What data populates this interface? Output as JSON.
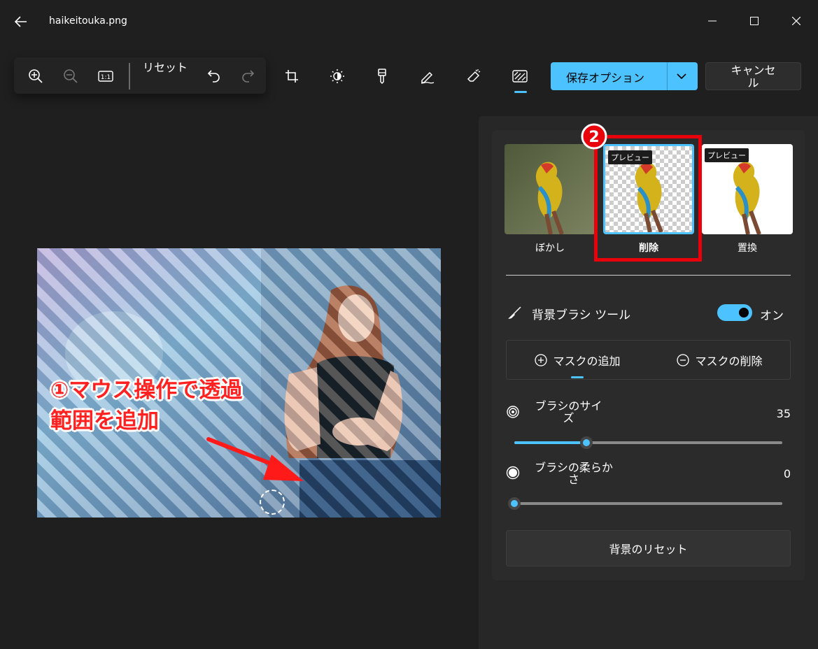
{
  "window": {
    "title": "haikeitouka.png"
  },
  "toolbar": {
    "reset_label": "リセット",
    "save_label": "保存オプション",
    "cancel_label": "キャンセル",
    "icons": [
      "zoom-in-icon",
      "zoom-out-icon",
      "actual-size-icon",
      "undo-icon",
      "redo-icon",
      "crop-icon",
      "brightness-icon",
      "filter-icon",
      "markup-icon",
      "erase-icon",
      "background-icon"
    ],
    "accent_color": "#4cc2ff"
  },
  "panel": {
    "options": [
      {
        "label": "ぼかし",
        "preview": ""
      },
      {
        "label": "削除",
        "preview": "プレビュー"
      },
      {
        "label": "置換",
        "preview": "プレビュー"
      }
    ],
    "brush_tool": {
      "label": "背景ブラシ ツール",
      "toggle_label": "オン",
      "on": true
    },
    "mask": {
      "add_label": "マスクの追加",
      "remove_label": "マスクの削除",
      "selected": "add"
    },
    "brush_size": {
      "label": "ブラシのサイズ",
      "value": "35",
      "fraction": 0.27
    },
    "brush_softness": {
      "label": "ブラシの柔らかさ",
      "value": "0",
      "fraction": 0.0
    },
    "reset_background_label": "背景のリセット"
  },
  "annotations": {
    "step1": "①マウス操作で透過範囲を追加",
    "step2": "②",
    "highlight_color": "#e8000b"
  }
}
